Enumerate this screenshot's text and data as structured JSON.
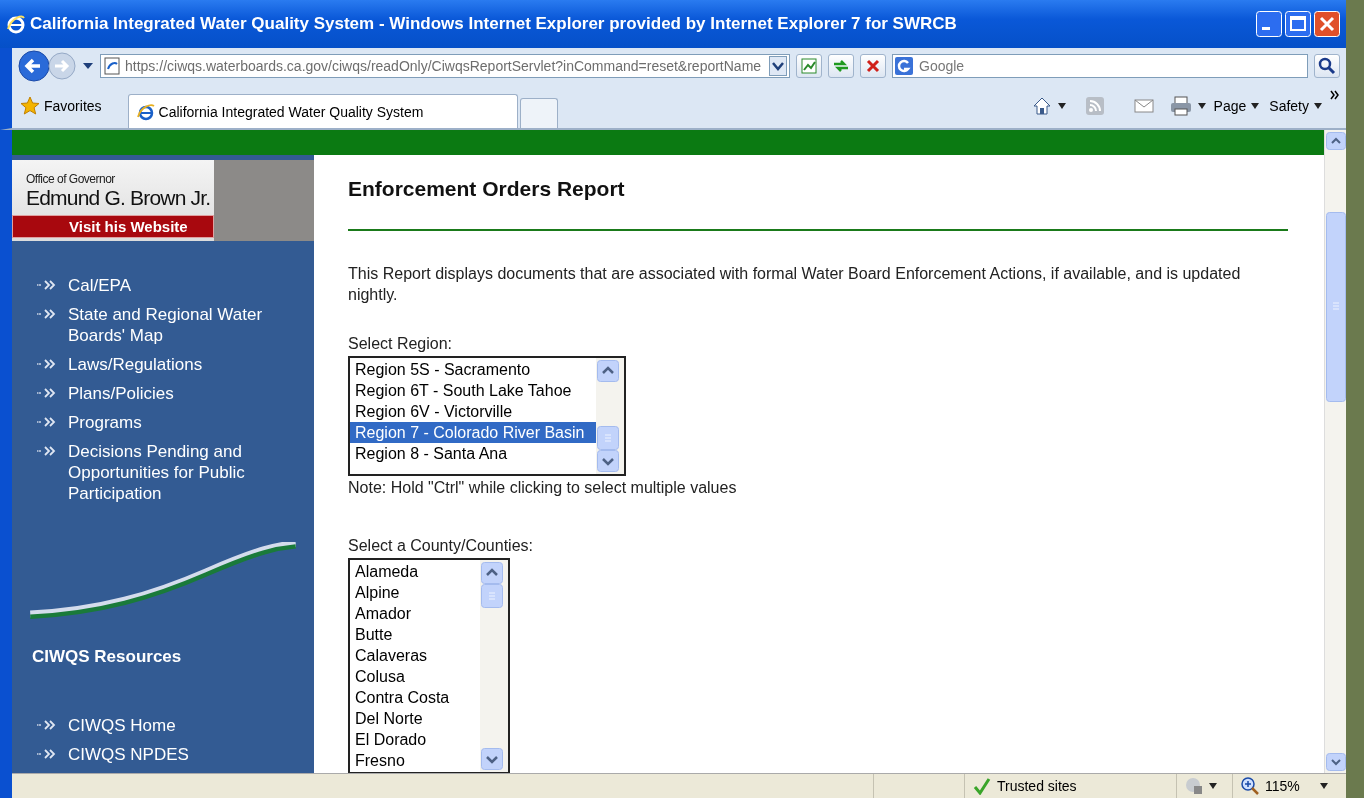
{
  "window": {
    "title": "California Integrated Water Quality System - Windows Internet Explorer provided by Internet Explorer 7 for SWRCB"
  },
  "address_bar": {
    "url": "https://ciwqs.waterboards.ca.gov/ciwqs/readOnly/CiwqsReportServlet?inCommand=reset&reportName"
  },
  "search": {
    "placeholder": "Google"
  },
  "favorites": {
    "label": "Favorites"
  },
  "tabs": [
    {
      "label": "California Integrated Water Quality System",
      "selected": true
    }
  ],
  "command_bar": [
    "Page",
    "Safety"
  ],
  "sidebar": {
    "banner": {
      "office": "Office of Governor",
      "name": "Edmund G. Brown Jr.",
      "link": "Visit his Website"
    },
    "nav": [
      {
        "label": "Cal/EPA"
      },
      {
        "label": "State and Regional Water Boards' Map"
      },
      {
        "label": "Laws/Regulations"
      },
      {
        "label": "Plans/Policies"
      },
      {
        "label": "Programs"
      },
      {
        "label": "Decisions Pending and Opportunities for Public Participation"
      }
    ],
    "resources_heading": "CIWQS Resources",
    "resources": [
      {
        "label": "CIWQS Home"
      },
      {
        "label": "CIWQS NPDES"
      }
    ]
  },
  "main": {
    "heading": "Enforcement Orders Report",
    "description": "This Report displays documents that are associated with formal Water Board Enforcement Actions, if available, and is updated nightly.",
    "region_select": {
      "label": "Select Region:",
      "options": [
        {
          "label": "Region 5S - Sacramento",
          "selected": false
        },
        {
          "label": "Region 6T - South Lake Tahoe",
          "selected": false
        },
        {
          "label": "Region 6V - Victorville",
          "selected": false
        },
        {
          "label": "Region 7 - Colorado River Basin",
          "selected": true
        },
        {
          "label": "Region 8 - Santa Ana",
          "selected": false
        }
      ],
      "note": "Note: Hold \"Ctrl\" while clicking to select multiple values"
    },
    "county_select": {
      "label": "Select a County/Counties:",
      "options": [
        {
          "label": "Alameda",
          "selected": false
        },
        {
          "label": "Alpine",
          "selected": false
        },
        {
          "label": "Amador",
          "selected": false
        },
        {
          "label": "Butte",
          "selected": false
        },
        {
          "label": "Calaveras",
          "selected": false
        },
        {
          "label": "Colusa",
          "selected": false
        },
        {
          "label": "Contra Costa",
          "selected": false
        },
        {
          "label": "Del Norte",
          "selected": false
        },
        {
          "label": "El Dorado",
          "selected": false
        },
        {
          "label": "Fresno",
          "selected": false
        }
      ]
    }
  },
  "status_bar": {
    "zone": "Trusted sites",
    "zoom": "115%"
  }
}
